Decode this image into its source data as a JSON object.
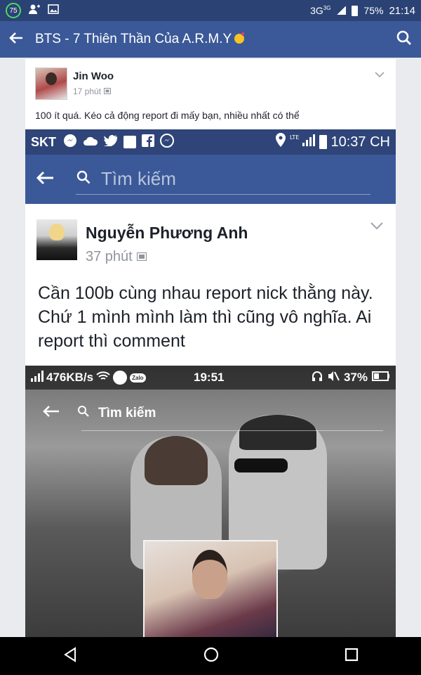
{
  "status_bar": {
    "notif_badge": "75",
    "network": "3G",
    "network_sup": "3G",
    "battery": "75%",
    "time": "21:14"
  },
  "header": {
    "title": "BTS - 7 Thiên Thần Của A.R.M.Y"
  },
  "post": {
    "author": "Jin Woo",
    "time": "17 phút",
    "text": "100 ít quá. Kéo cả động report đi mấy bạn, nhiều nhất có thể"
  },
  "screenshot": {
    "status": {
      "carrier": "SKT",
      "time": "10:37 CH"
    },
    "search_placeholder": "Tìm kiếm",
    "post": {
      "author": "Nguyễn Phương Anh",
      "time": "37 phút",
      "text": "Cần 100b cùng nhau report nick thằng này. Chứ 1 mình mình làm thì cũng vô nghĩa. Ai report thì comment"
    },
    "photo": {
      "speed": "476KB/s",
      "app_label": "Zalo",
      "time": "19:51",
      "battery": "37%",
      "search_label": "Tìm kiếm"
    }
  },
  "colors": {
    "fb_blue": "#3b5998",
    "status_dark": "#2b4274"
  }
}
